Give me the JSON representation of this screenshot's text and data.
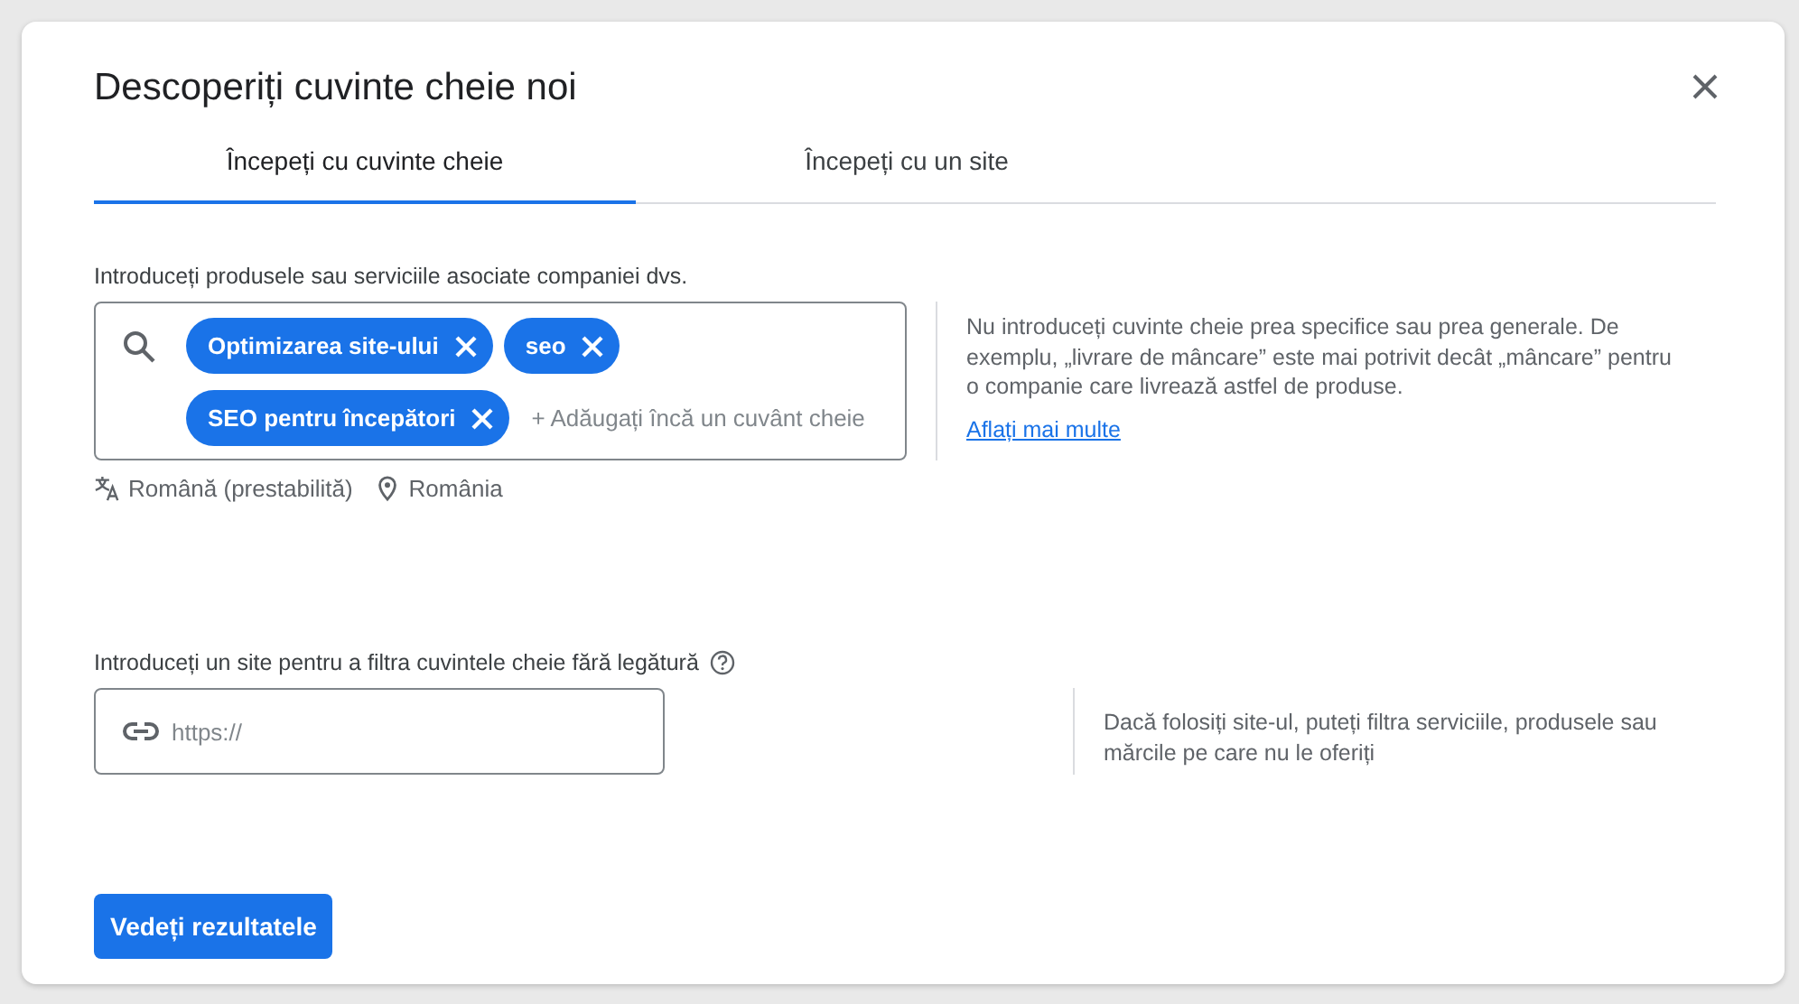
{
  "dialog": {
    "title": "Descoperiți cuvinte cheie noi",
    "tabs": [
      {
        "label": "Începeți cu cuvinte cheie",
        "selected": true
      },
      {
        "label": "Începeți cu un site",
        "selected": false
      }
    ],
    "keywords": {
      "label": "Introduceți produsele sau serviciile asociate companiei dvs.",
      "chips": [
        "Optimizarea site-ului",
        "seo",
        "SEO pentru începători"
      ],
      "placeholder": "+ Adăugați încă un cuvânt cheie",
      "language": "Română (prestabilită)",
      "location": "România",
      "hint": "Nu introduceți cuvinte cheie prea specifice sau prea generale. De exemplu, „livrare de mâncare” este mai potrivit decât „mâncare” pentru o companie care livrează astfel de produse.",
      "link": "Aflați mai multe"
    },
    "site": {
      "label": "Introduceți un site pentru a filtra cuvintele cheie fără legătură",
      "placeholder": "https://",
      "hint": "Dacă folosiți site-ul, puteți filtra serviciile, produsele sau mărcile pe care nu le oferiți"
    },
    "button": "Vedeți rezultatele"
  }
}
